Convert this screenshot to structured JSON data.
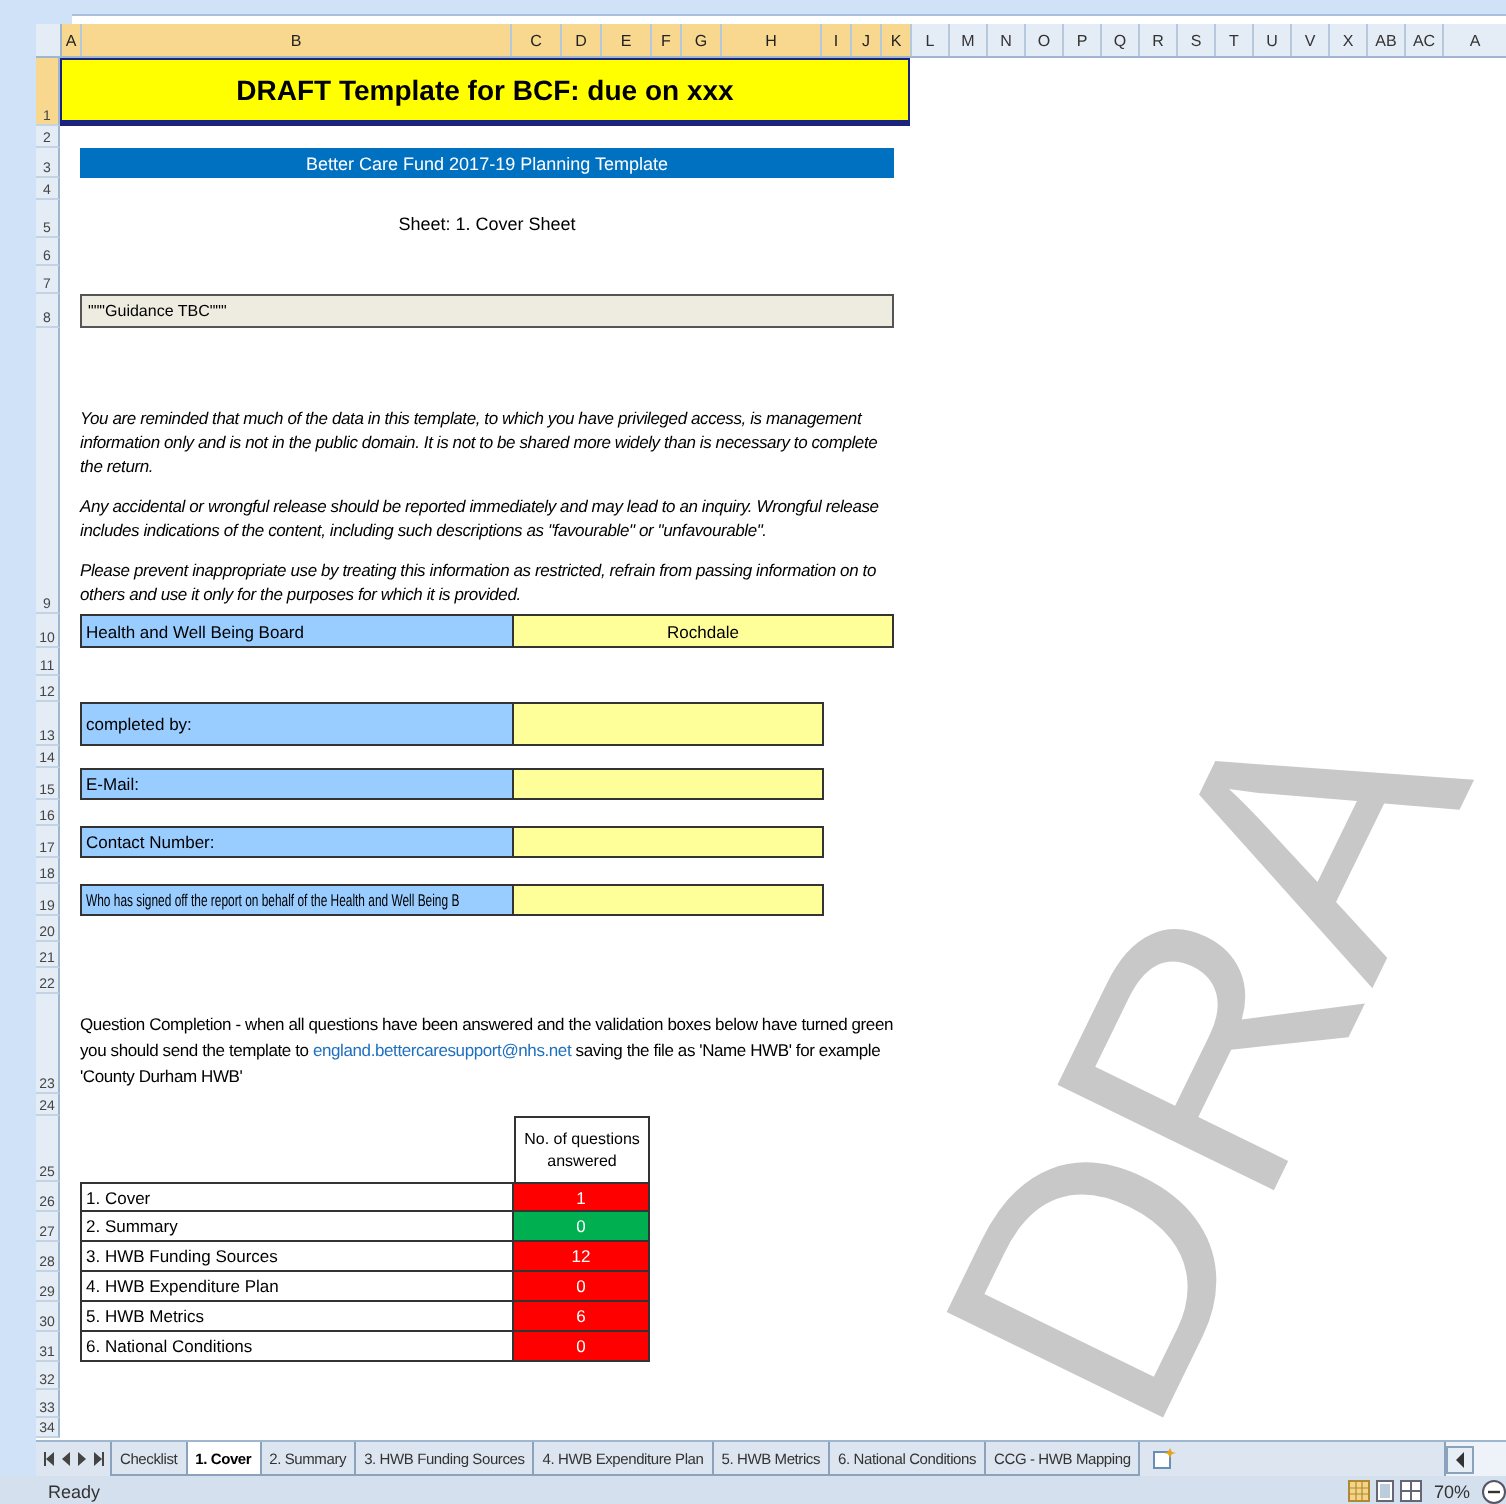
{
  "columns": [
    {
      "label": "A",
      "selected": true
    },
    {
      "label": "B",
      "selected": true
    },
    {
      "label": "C",
      "selected": true
    },
    {
      "label": "D",
      "selected": true
    },
    {
      "label": "E",
      "selected": true
    },
    {
      "label": "F",
      "selected": true
    },
    {
      "label": "G",
      "selected": true
    },
    {
      "label": "H",
      "selected": true
    },
    {
      "label": "I",
      "selected": true
    },
    {
      "label": "J",
      "selected": true
    },
    {
      "label": "K",
      "selected": true
    },
    {
      "label": "L",
      "selected": false
    },
    {
      "label": "M",
      "selected": false
    },
    {
      "label": "N",
      "selected": false
    },
    {
      "label": "O",
      "selected": false
    },
    {
      "label": "P",
      "selected": false
    },
    {
      "label": "Q",
      "selected": false
    },
    {
      "label": "R",
      "selected": false
    },
    {
      "label": "S",
      "selected": false
    },
    {
      "label": "T",
      "selected": false
    },
    {
      "label": "U",
      "selected": false
    },
    {
      "label": "V",
      "selected": false
    },
    {
      "label": "X",
      "selected": false
    },
    {
      "label": "AB",
      "selected": false
    },
    {
      "label": "AC",
      "selected": false
    },
    {
      "label": "A",
      "selected": false
    }
  ],
  "rows": [
    {
      "label": "1",
      "selected": true
    },
    {
      "label": "2",
      "selected": false
    },
    {
      "label": "3",
      "selected": false
    },
    {
      "label": "4",
      "selected": false
    },
    {
      "label": "5",
      "selected": false
    },
    {
      "label": "6",
      "selected": false
    },
    {
      "label": "7",
      "selected": false
    },
    {
      "label": "8",
      "selected": false
    },
    {
      "label": "9",
      "selected": false
    },
    {
      "label": "10",
      "selected": false
    },
    {
      "label": "11",
      "selected": false
    },
    {
      "label": "12",
      "selected": false
    },
    {
      "label": "13",
      "selected": false
    },
    {
      "label": "14",
      "selected": false
    },
    {
      "label": "15",
      "selected": false
    },
    {
      "label": "16",
      "selected": false
    },
    {
      "label": "17",
      "selected": false
    },
    {
      "label": "18",
      "selected": false
    },
    {
      "label": "19",
      "selected": false
    },
    {
      "label": "20",
      "selected": false
    },
    {
      "label": "21",
      "selected": false
    },
    {
      "label": "22",
      "selected": false
    },
    {
      "label": "23",
      "selected": false
    },
    {
      "label": "24",
      "selected": false
    },
    {
      "label": "25",
      "selected": false
    },
    {
      "label": "26",
      "selected": false
    },
    {
      "label": "27",
      "selected": false
    },
    {
      "label": "28",
      "selected": false
    },
    {
      "label": "29",
      "selected": false
    },
    {
      "label": "30",
      "selected": false
    },
    {
      "label": "31",
      "selected": false
    },
    {
      "label": "32",
      "selected": false
    },
    {
      "label": "33",
      "selected": false
    },
    {
      "label": "34",
      "selected": false
    }
  ],
  "title": "DRAFT Template for BCF: due on xxx",
  "banner": "Better Care Fund 2017-19 Planning Template",
  "sheet_heading": "Sheet: 1. Cover Sheet",
  "guidance": "\"\"\"Guidance TBC\"\"\"",
  "paragraphs": [
    "You are reminded that much of the data in this template, to which you have privileged access, is management information only and is not in the public domain. It is not to be shared more widely than is necessary to complete the return.",
    "Any accidental or wrongful release should be reported immediately and may lead to an inquiry. Wrongful release includes indications of the content, including such descriptions as \"favourable\" or \"unfavourable\".",
    "Please prevent inappropriate use by treating this information as restricted, refrain from passing information on to others and use it only for the purposes for which it is provided."
  ],
  "board": {
    "label": "Health and Well Being Board",
    "value": "Rochdale"
  },
  "fields": [
    {
      "label": "completed by:"
    },
    {
      "label": "E-Mail:"
    },
    {
      "label": "Contact Number:"
    },
    {
      "label": "Who has signed off the report on behalf of the Health and Well Being B"
    }
  ],
  "completion_note": {
    "before": "Question Completion - when all questions have been answered and the validation boxes below have turned green you should send the template to ",
    "link": "england.bettercaresupport@nhs.net",
    "after": " saving the file as 'Name HWB' for example 'County Durham HWB'"
  },
  "completion_table": {
    "header": "No. of questions answered",
    "rows": [
      {
        "label": "1. Cover",
        "value": "1",
        "color": "#ff0000"
      },
      {
        "label": "2. Summary",
        "value": "0",
        "color": "#00b050"
      },
      {
        "label": "3. HWB Funding Sources",
        "value": "12",
        "color": "#ff0000"
      },
      {
        "label": "4. HWB Expenditure Plan",
        "value": "0",
        "color": "#ff0000"
      },
      {
        "label": "5. HWB Metrics",
        "value": "6",
        "color": "#ff0000"
      },
      {
        "label": "6. National Conditions",
        "value": "0",
        "color": "#ff0000"
      }
    ]
  },
  "watermark": "DRA",
  "sheet_tabs": [
    {
      "label": "Checklist",
      "selected": false
    },
    {
      "label": "1. Cover",
      "selected": true
    },
    {
      "label": "2. Summary",
      "selected": false
    },
    {
      "label": "3. HWB Funding Sources",
      "selected": false
    },
    {
      "label": "4. HWB Expenditure Plan",
      "selected": false
    },
    {
      "label": "5. HWB Metrics",
      "selected": false
    },
    {
      "label": "6. National Conditions",
      "selected": false
    },
    {
      "label": "CCG - HWB Mapping",
      "selected": false
    }
  ],
  "status_bar": {
    "status": "Ready",
    "zoom": "70%"
  }
}
